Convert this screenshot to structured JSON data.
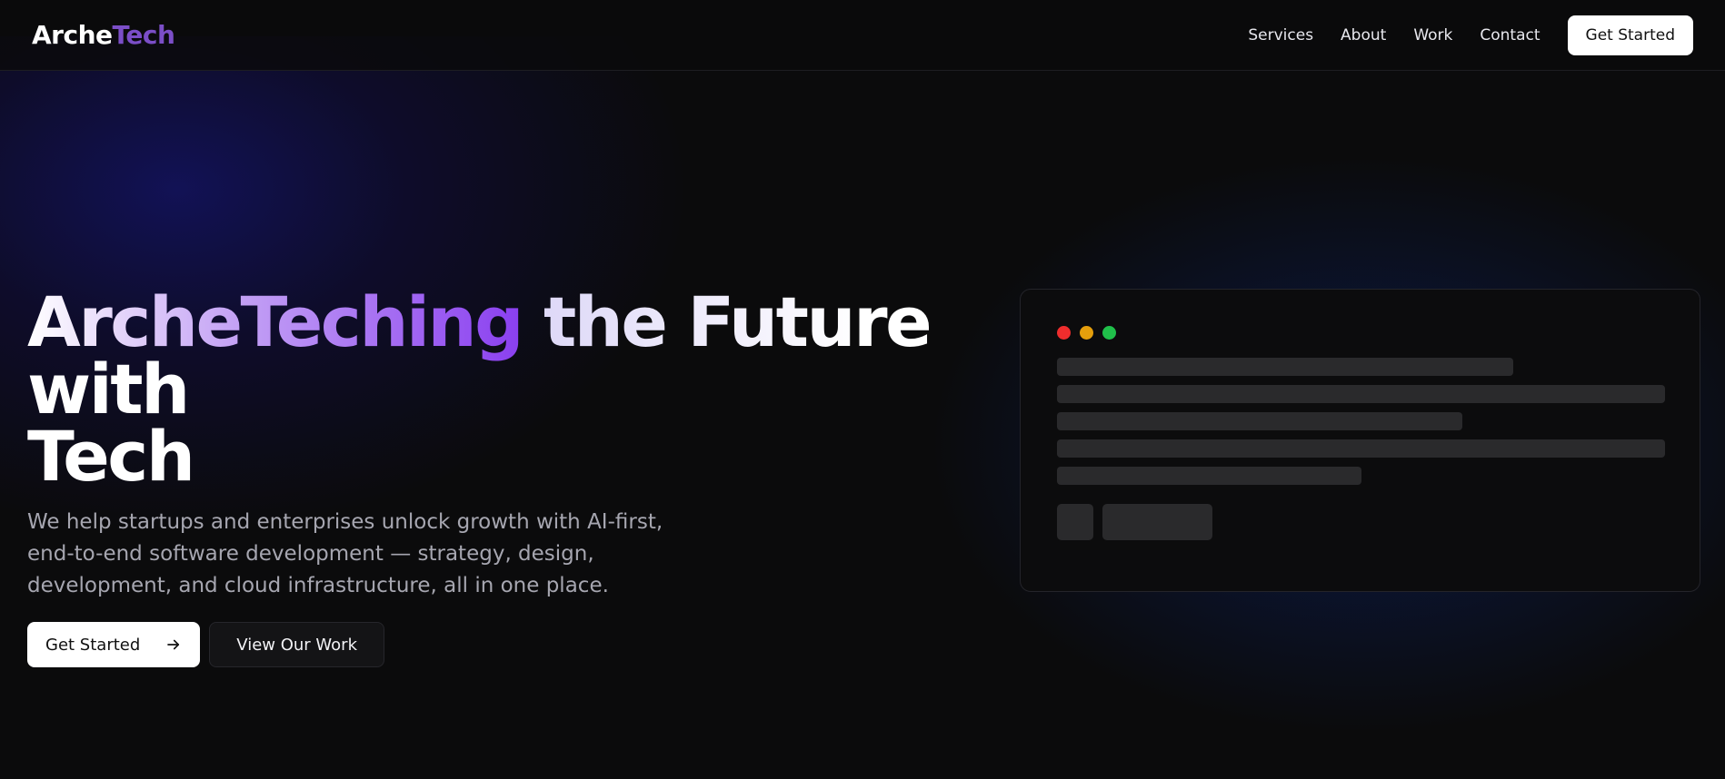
{
  "header": {
    "logo_part1": "Arche",
    "logo_part2": "Tech",
    "nav": [
      {
        "label": "Services"
      },
      {
        "label": "About"
      },
      {
        "label": "Work"
      },
      {
        "label": "Contact"
      }
    ],
    "cta_label": "Get Started"
  },
  "hero": {
    "headline_gradient": "ArcheTeching",
    "headline_rest": " the Future with",
    "headline_line2": "Tech",
    "subtext": "We help startups and enterprises unlock growth with AI-first, end-to-end software development — strategy, design, development, and cloud infrastructure, all in one place.",
    "primary_button": "Get Started",
    "secondary_button": "View Our Work"
  },
  "mockup": {
    "window_dot_colors": [
      "#ef2d2d",
      "#e59f0c",
      "#20c04a"
    ],
    "placeholder_color": "#2a2a2c"
  },
  "colors": {
    "background": "#0b0b0c",
    "logo_accent": "#7b4ec7",
    "headline_gradient_end": "#8a3ff0"
  }
}
